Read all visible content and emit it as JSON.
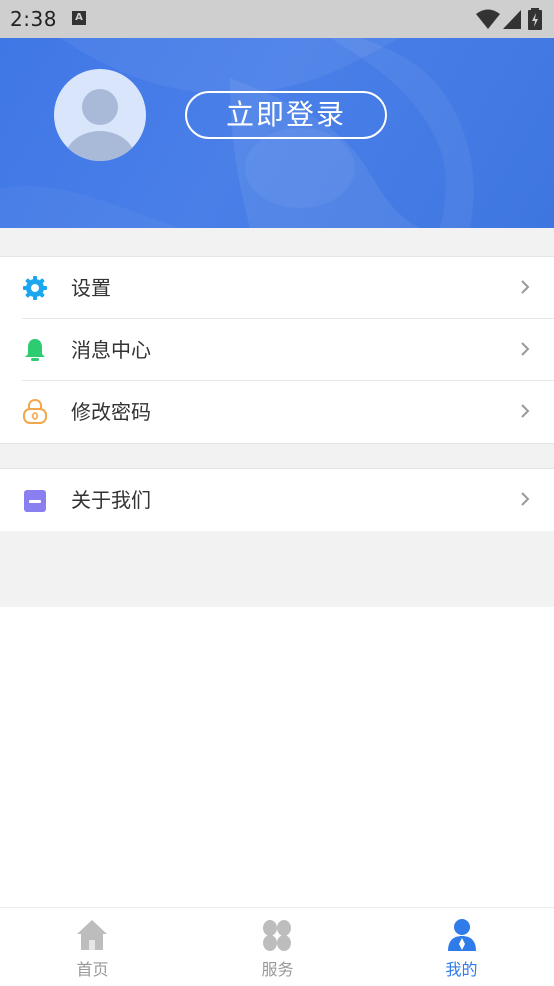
{
  "status_bar": {
    "time": "2:38",
    "notification_icon": "A"
  },
  "header": {
    "login_label": "立即登录"
  },
  "menu": {
    "group1": [
      {
        "label": "设置",
        "icon": "gear-icon",
        "color": "#1aa7f0"
      },
      {
        "label": "消息中心",
        "icon": "bell-icon",
        "color": "#2ecc71"
      },
      {
        "label": "修改密码",
        "icon": "lock-icon",
        "color": "#f4a64a"
      }
    ],
    "group2": [
      {
        "label": "关于我们",
        "icon": "info-card-icon",
        "color": "#8a7ff0"
      }
    ]
  },
  "bottom_nav": {
    "items": [
      {
        "label": "首页",
        "icon": "home-icon",
        "active": false
      },
      {
        "label": "服务",
        "icon": "services-icon",
        "active": false
      },
      {
        "label": "我的",
        "icon": "profile-icon",
        "active": true
      }
    ],
    "active_color": "#2f7be9",
    "inactive_color": "#999999"
  }
}
